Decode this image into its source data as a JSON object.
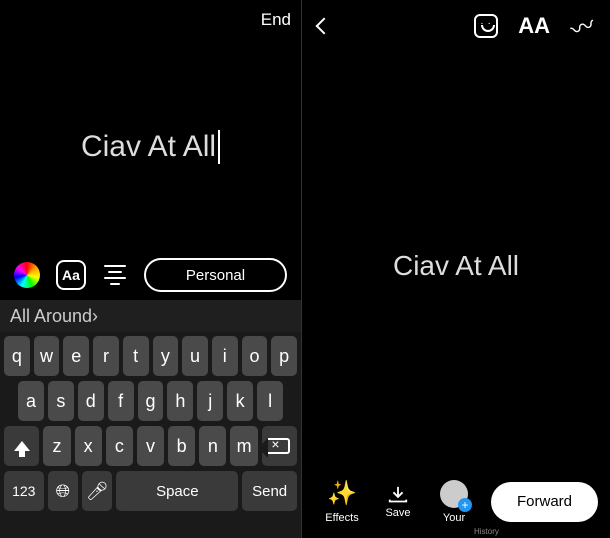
{
  "left": {
    "top_right": "End",
    "story_text": "Ciav At All",
    "tools": {
      "font_box": "Aa",
      "style_pill": "Personal"
    },
    "suggestion": "All Around›",
    "keyboard": {
      "row1": [
        "q",
        "w",
        "e",
        "r",
        "t",
        "y",
        "u",
        "i",
        "o",
        "p"
      ],
      "row2": [
        "a",
        "s",
        "d",
        "f",
        "g",
        "h",
        "j",
        "k",
        "l"
      ],
      "row3": [
        "z",
        "x",
        "c",
        "v",
        "b",
        "n",
        "m"
      ],
      "num_key": "123",
      "space": "Space",
      "send": "Send"
    }
  },
  "right": {
    "aa": "AA",
    "center_text": "Ciav At All",
    "bottom": {
      "effects": "Effects",
      "save": "Save",
      "your": "Your",
      "history": "History",
      "forward": "Forward"
    }
  }
}
